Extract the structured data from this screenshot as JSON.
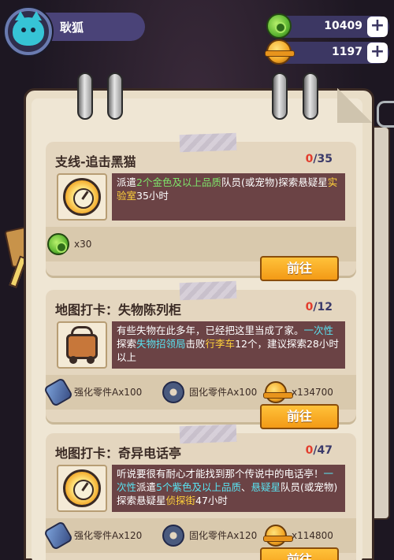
{
  "header": {
    "player_name": "耿狐",
    "avatar_icon": "cat-avatar-icon",
    "currencies": [
      {
        "icon": "green-coin-icon",
        "value": "10409",
        "plus": "+"
      },
      {
        "icon": "gold-coin-icon",
        "value": "1197",
        "plus": "+"
      }
    ]
  },
  "tasks": [
    {
      "title": "支线-追击黑猫",
      "progress_current": "0",
      "progress_total": "/35",
      "icon": "clock-icon",
      "desc_parts": [
        {
          "t": "派遣",
          "c": ""
        },
        {
          "t": "2个金色及以上品质",
          "c": "hl-g"
        },
        {
          "t": "队员(或宠物)探索悬疑星",
          "c": ""
        },
        {
          "t": "实验室",
          "c": "hl-y"
        },
        {
          "t": "35小时",
          "c": ""
        }
      ],
      "rewards": [
        {
          "icon": "green-coin-icon",
          "label": "x30"
        }
      ],
      "button": "前往"
    },
    {
      "title": "地图打卡：失物陈列柜",
      "progress_current": "0",
      "progress_total": "/12",
      "icon": "cart-icon",
      "desc_parts": [
        {
          "t": "有些失物在此多年，已经把这里当成了家。",
          "c": ""
        },
        {
          "t": "一次性",
          "c": "hl-c"
        },
        {
          "t": "探索",
          "c": ""
        },
        {
          "t": "失物招领局",
          "c": "hl-c"
        },
        {
          "t": "击败",
          "c": ""
        },
        {
          "t": "行李车",
          "c": "hl-y"
        },
        {
          "t": "12个，建议探索28小时以上",
          "c": ""
        }
      ],
      "rewards": [
        {
          "icon": "bolt-icon",
          "label": "强化零件Ax100"
        },
        {
          "icon": "nut-icon",
          "label": "固化零件Ax100"
        },
        {
          "icon": "gold-coin-icon",
          "label": "x134700"
        }
      ],
      "button": "前往"
    },
    {
      "title": "地图打卡：奇异电话亭",
      "progress_current": "0",
      "progress_total": "/47",
      "icon": "clock-icon",
      "desc_parts": [
        {
          "t": "听说要很有耐心才能找到那个传说中的电话亭！",
          "c": ""
        },
        {
          "t": "一次性",
          "c": "hl-c"
        },
        {
          "t": "派遣",
          "c": ""
        },
        {
          "t": "5个紫色及以上品质",
          "c": "hl-c"
        },
        {
          "t": "、",
          "c": ""
        },
        {
          "t": "悬疑星",
          "c": "hl-c"
        },
        {
          "t": "队员(或宠物)探索悬疑星",
          "c": ""
        },
        {
          "t": "侦探街",
          "c": "hl-y"
        },
        {
          "t": "47小时",
          "c": ""
        }
      ],
      "rewards": [
        {
          "icon": "bolt-icon",
          "label": "强化零件Ax120"
        },
        {
          "icon": "nut-icon",
          "label": "固化零件Ax120"
        },
        {
          "icon": "gold-coin-icon",
          "label": "x114800"
        }
      ],
      "button": "前往"
    }
  ]
}
